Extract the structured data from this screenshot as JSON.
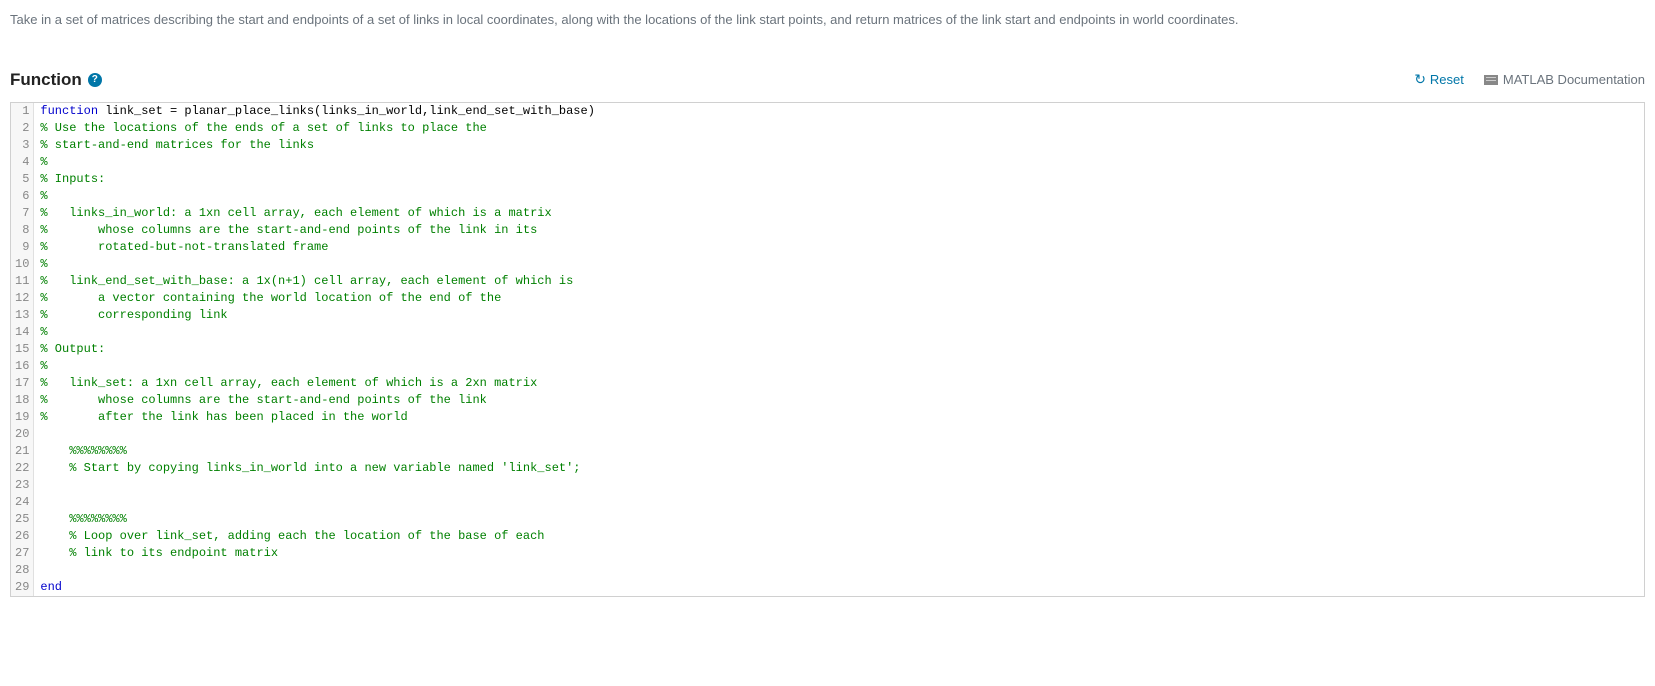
{
  "description": "Take in a set of matrices describing the start and endpoints of a set of links in local coordinates, along with the locations of the link start points, and return matrices of the link start and endpoints in world coordinates.",
  "section": {
    "title": "Function",
    "help_symbol": "?"
  },
  "actions": {
    "reset_label": "Reset",
    "reset_glyph": "↻",
    "doc_label": "MATLAB Documentation"
  },
  "code": {
    "lines": [
      {
        "n": "1",
        "tokens": [
          {
            "t": "function",
            "c": "keyword"
          },
          {
            "t": " link_set = planar_place_links(links_in_world,link_end_set_with_base)",
            "c": "plain"
          }
        ]
      },
      {
        "n": "2",
        "tokens": [
          {
            "t": "% Use the locations of the ends of a set of links to place the",
            "c": "comment"
          }
        ]
      },
      {
        "n": "3",
        "tokens": [
          {
            "t": "% start-and-end matrices for the links",
            "c": "comment"
          }
        ]
      },
      {
        "n": "4",
        "tokens": [
          {
            "t": "%",
            "c": "comment"
          }
        ]
      },
      {
        "n": "5",
        "tokens": [
          {
            "t": "% Inputs:",
            "c": "comment"
          }
        ]
      },
      {
        "n": "6",
        "tokens": [
          {
            "t": "%",
            "c": "comment"
          }
        ]
      },
      {
        "n": "7",
        "tokens": [
          {
            "t": "%   links_in_world: a 1xn cell array, each element of which is a matrix",
            "c": "comment"
          }
        ]
      },
      {
        "n": "8",
        "tokens": [
          {
            "t": "%       whose columns are the start-and-end points of the link in its",
            "c": "comment"
          }
        ]
      },
      {
        "n": "9",
        "tokens": [
          {
            "t": "%       rotated-but-not-translated frame",
            "c": "comment"
          }
        ]
      },
      {
        "n": "10",
        "tokens": [
          {
            "t": "%",
            "c": "comment"
          }
        ]
      },
      {
        "n": "11",
        "tokens": [
          {
            "t": "%   link_end_set_with_base: a 1x(n+1) cell array, each element of which is",
            "c": "comment"
          }
        ]
      },
      {
        "n": "12",
        "tokens": [
          {
            "t": "%       a vector containing the world location of the end of the",
            "c": "comment"
          }
        ]
      },
      {
        "n": "13",
        "tokens": [
          {
            "t": "%       corresponding link",
            "c": "comment"
          }
        ]
      },
      {
        "n": "14",
        "tokens": [
          {
            "t": "%",
            "c": "comment"
          }
        ]
      },
      {
        "n": "15",
        "tokens": [
          {
            "t": "% Output:",
            "c": "comment"
          }
        ]
      },
      {
        "n": "16",
        "tokens": [
          {
            "t": "%",
            "c": "comment"
          }
        ]
      },
      {
        "n": "17",
        "tokens": [
          {
            "t": "%   link_set: a 1xn cell array, each element of which is a 2xn matrix",
            "c": "comment"
          }
        ]
      },
      {
        "n": "18",
        "tokens": [
          {
            "t": "%       whose columns are the start-and-end points of the link",
            "c": "comment"
          }
        ]
      },
      {
        "n": "19",
        "tokens": [
          {
            "t": "%       after the link has been placed in the world",
            "c": "comment"
          }
        ]
      },
      {
        "n": "20",
        "tokens": []
      },
      {
        "n": "21",
        "tokens": [
          {
            "t": "    %%%%%%%%",
            "c": "comment"
          }
        ]
      },
      {
        "n": "22",
        "tokens": [
          {
            "t": "    % Start by copying links_in_world into a new variable named 'link_set';",
            "c": "comment"
          }
        ]
      },
      {
        "n": "23",
        "tokens": []
      },
      {
        "n": "24",
        "tokens": []
      },
      {
        "n": "25",
        "tokens": [
          {
            "t": "    %%%%%%%%",
            "c": "comment"
          }
        ]
      },
      {
        "n": "26",
        "tokens": [
          {
            "t": "    % Loop over link_set, adding each the location of the base of each",
            "c": "comment"
          }
        ]
      },
      {
        "n": "27",
        "tokens": [
          {
            "t": "    % link to its endpoint matrix",
            "c": "comment"
          }
        ]
      },
      {
        "n": "28",
        "tokens": []
      },
      {
        "n": "29",
        "tokens": [
          {
            "t": "end",
            "c": "keyword"
          }
        ]
      }
    ]
  }
}
